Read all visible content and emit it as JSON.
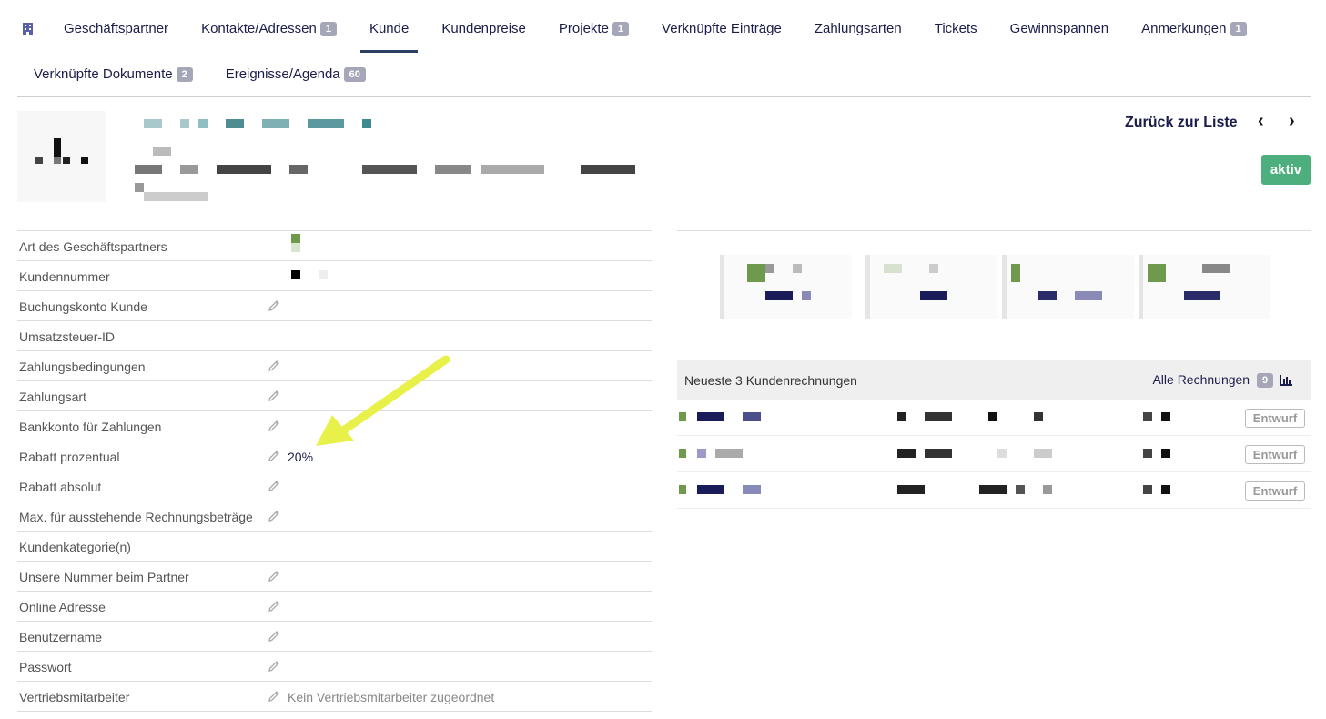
{
  "tabs": {
    "row1": [
      {
        "label": "Geschäftspartner",
        "badge": ""
      },
      {
        "label": "Kontakte/Adressen",
        "badge": "1"
      },
      {
        "label": "Kunde",
        "badge": ""
      },
      {
        "label": "Kundenpreise",
        "badge": ""
      },
      {
        "label": "Projekte",
        "badge": "1"
      },
      {
        "label": "Verknüpfte Einträge",
        "badge": ""
      },
      {
        "label": "Zahlungsarten",
        "badge": ""
      },
      {
        "label": "Tickets",
        "badge": ""
      },
      {
        "label": "Gewinnspannen",
        "badge": ""
      },
      {
        "label": "Anmerkungen",
        "badge": "1"
      }
    ],
    "row2": [
      {
        "label": "Verknüpfte Dokumente",
        "badge": "2"
      },
      {
        "label": "Ereignisse/Agenda",
        "badge": "60"
      }
    ],
    "active": "Kunde"
  },
  "header": {
    "back_label": "Zurück zur Liste",
    "prev_icon": "‹",
    "next_icon": "›",
    "status": "aktiv",
    "status_color": "#4caf7d"
  },
  "fields": [
    {
      "label": "Art des Geschäftspartners",
      "editable": false,
      "value": ""
    },
    {
      "label": "Kundennummer",
      "editable": false,
      "value": ""
    },
    {
      "label": "Buchungskonto Kunde",
      "editable": true,
      "value": ""
    },
    {
      "label": "Umsatzsteuer-ID",
      "editable": false,
      "value": ""
    },
    {
      "label": "Zahlungsbedingungen",
      "editable": true,
      "value": ""
    },
    {
      "label": "Zahlungsart",
      "editable": true,
      "value": ""
    },
    {
      "label": "Bankkonto für Zahlungen",
      "editable": true,
      "value": ""
    },
    {
      "label": "Rabatt prozentual",
      "editable": true,
      "value": "20%"
    },
    {
      "label": "Rabatt absolut",
      "editable": true,
      "value": ""
    },
    {
      "label": "Max. für ausstehende Rechnungsbeträge",
      "editable": true,
      "value": ""
    },
    {
      "label": "Kundenkategorie(n)",
      "editable": false,
      "value": ""
    },
    {
      "label": "Unsere Nummer beim Partner",
      "editable": true,
      "value": ""
    },
    {
      "label": "Online Adresse",
      "editable": true,
      "value": ""
    },
    {
      "label": "Benutzername",
      "editable": true,
      "value": ""
    },
    {
      "label": "Passwort",
      "editable": true,
      "value": ""
    },
    {
      "label": "Vertriebsmitarbeiter",
      "editable": true,
      "value": "Kein Vertriebsmitarbeiter zugeordnet",
      "muted": true
    }
  ],
  "invoices": {
    "title": "Neueste 3 Kundenrechnungen",
    "all_label": "Alle Rechnungen",
    "all_count": "9",
    "rows": [
      {
        "status": "Entwurf"
      },
      {
        "status": "Entwurf"
      },
      {
        "status": "Entwurf"
      }
    ]
  },
  "icons": {
    "building": "building-icon",
    "edit": "pencil-icon",
    "chart": "bar-chart-icon",
    "annotation": "yellow-arrow"
  }
}
